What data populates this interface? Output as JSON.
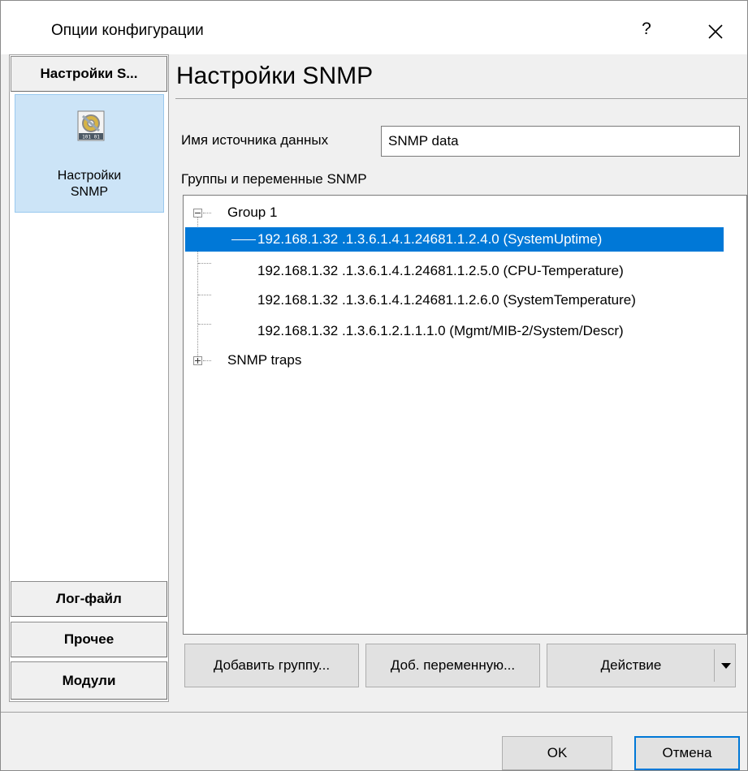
{
  "window": {
    "title": "Опции конфигурации",
    "help_glyph": "?",
    "close_icon": "close-icon"
  },
  "sidebar": {
    "top_category": "Настройки S...",
    "nav_item": {
      "label_line1": "Настройки",
      "label_line2": "SNMP",
      "icon": "snmp-settings-icon",
      "icon_text": "101 01"
    },
    "bottom_categories": [
      "Лог-файл",
      "Прочее",
      "Модули"
    ]
  },
  "main": {
    "title": "Настройки SNMP",
    "datasource": {
      "label": "Имя источника данных",
      "value": "SNMP data"
    },
    "tree_label": "Группы и переменные SNMP",
    "tree": {
      "group": {
        "label": "Group 1",
        "expanded": true
      },
      "variables": [
        {
          "label": "192.168.1.32 .1.3.6.1.4.1.24681.1.2.4.0 (SystemUptime)",
          "selected": true
        },
        {
          "label": "192.168.1.32 .1.3.6.1.4.1.24681.1.2.5.0 (CPU-Temperature)",
          "selected": false
        },
        {
          "label": "192.168.1.32 .1.3.6.1.4.1.24681.1.2.6.0 (SystemTemperature)",
          "selected": false
        },
        {
          "label": "192.168.1.32 .1.3.6.1.2.1.1.1.0 (Mgmt/MIB-2/System/Descr)",
          "selected": false
        }
      ],
      "traps": {
        "label": "SNMP traps",
        "expanded": false
      }
    },
    "buttons": {
      "add_group": "Добавить группу...",
      "add_variable": "Доб. переменную...",
      "action": "Действие"
    }
  },
  "footer": {
    "ok": "OK",
    "cancel": "Отмена"
  },
  "colors": {
    "selection": "#0078d7",
    "nav_selected_bg": "#cce4f7",
    "nav_selected_border": "#99c9ef",
    "dialog_bg": "#f0f0f0"
  }
}
